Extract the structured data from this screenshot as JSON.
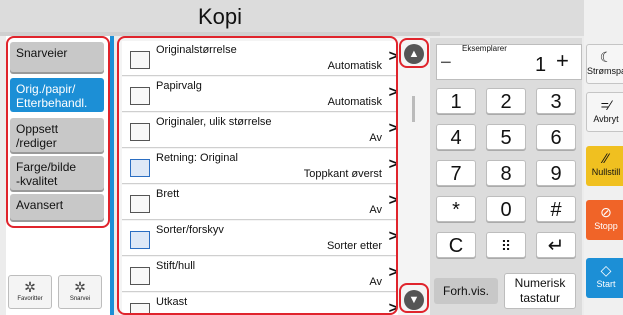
{
  "header": {
    "title": "Kopi"
  },
  "tabs": [
    {
      "label": "Snarveier",
      "active": false
    },
    {
      "label": "Orig./papir/\nEtterbehandl.",
      "active": true
    },
    {
      "label": "Oppsett\n/rediger",
      "active": false
    },
    {
      "label": "Farge/bilde\n-kvalitet",
      "active": false
    },
    {
      "label": "Avansert",
      "active": false
    }
  ],
  "bottom_buttons": [
    {
      "label": "Favoritter",
      "icon": "gear-star-icon"
    },
    {
      "label": "Snarvei",
      "icon": "shortcut-icon"
    }
  ],
  "settings": [
    {
      "label": "Originalstørrelse",
      "value": "Automatisk",
      "icon": "original-size-icon"
    },
    {
      "label": "Papirvalg",
      "value": "Automatisk",
      "icon": "paper-icon"
    },
    {
      "label": "Originaler, ulik størrelse",
      "value": "Av",
      "icon": "mixed-originals-icon"
    },
    {
      "label": "Retning: Original",
      "value": "Toppkant øverst",
      "icon": "orientation-icon"
    },
    {
      "label": "Brett",
      "value": "Av",
      "icon": "fold-icon"
    },
    {
      "label": "Sorter/forskyv",
      "value": "Sorter etter",
      "icon": "collate-icon"
    },
    {
      "label": "Stift/hull",
      "value": "Av",
      "icon": "staple-icon"
    },
    {
      "label": "Utkast",
      "value": "",
      "icon": "output-icon"
    }
  ],
  "copies": {
    "label": "Eksemplarer",
    "value": "1"
  },
  "keypad": [
    "1",
    "2",
    "3",
    "4",
    "5",
    "6",
    "7",
    "8",
    "9",
    "*",
    "0",
    "#"
  ],
  "keypad_actions": {
    "clear": "C",
    "dots": "⠿",
    "enter": "↵"
  },
  "footer": {
    "preview": "Forh.vis.",
    "numeric": "Numerisk\ntastatur"
  },
  "right_buttons": [
    {
      "label": "Strømspar",
      "icon": "moon-icon",
      "color": "#f6f6f6"
    },
    {
      "label": "Avbryt",
      "icon": "cancel-icon",
      "color": "#f6f6f6"
    },
    {
      "label": "Nullstill",
      "icon": "reset-icon",
      "color": "#f0c020"
    },
    {
      "label": "Stopp",
      "icon": "stop-icon",
      "color": "#f06428"
    },
    {
      "label": "Start",
      "icon": "start-icon",
      "color": "#1c8fd6"
    }
  ],
  "colors": {
    "accent": "#1c8fd6",
    "highlight": "#e0242c"
  }
}
